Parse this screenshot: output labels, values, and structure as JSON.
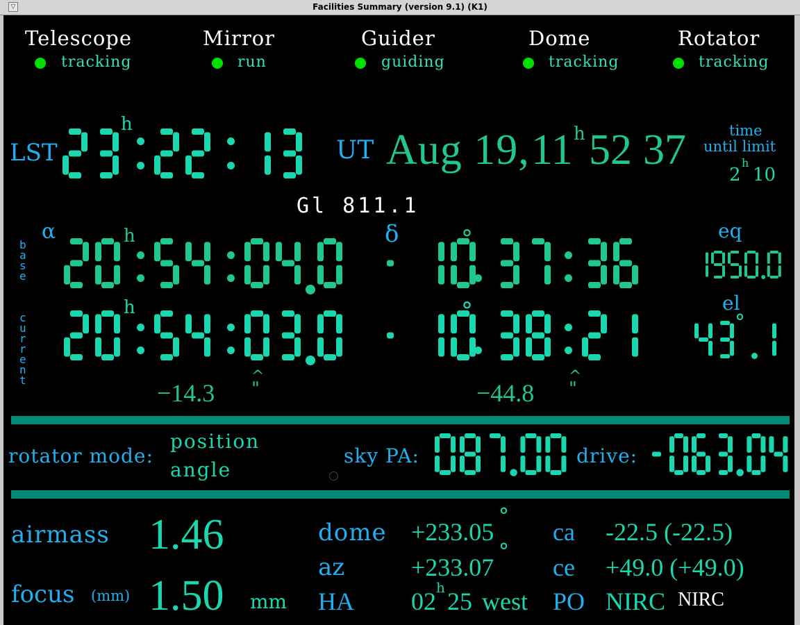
{
  "window": {
    "title": "Facilities Summary (version 9.1) (K1)",
    "menu_icon": "window-menu-icon",
    "menu_glyph": "▽"
  },
  "colors": {
    "background": "#000000",
    "label": "#1fb0f0",
    "digits": "#19d8b0",
    "ok_indicator": "#00e000",
    "separator": "#008a78"
  },
  "status": {
    "telescope": {
      "label": "Telescope",
      "state": "tracking"
    },
    "mirror": {
      "label": "Mirror",
      "state": "run"
    },
    "guider": {
      "label": "Guider",
      "state": "guiding"
    },
    "dome": {
      "label": "Dome",
      "state": "tracking"
    },
    "rotator": {
      "label": "Rotator",
      "state": "tracking"
    }
  },
  "time": {
    "lst_label": "LST",
    "lst": {
      "h": "23",
      "h_unit": "h",
      "m": "22",
      "s": "13"
    },
    "ut_label": "UT",
    "ut_date": "Aug 19,",
    "ut_hour": "11",
    "ut_h_unit": "h",
    "ut_min": "52",
    "ut_sec": "37",
    "limit_label_1": "time",
    "limit_label_2": "until limit",
    "limit_h": "2",
    "limit_h_unit": "h",
    "limit_m": "10"
  },
  "target": {
    "name": "Gl 811.1"
  },
  "coords": {
    "alpha_symbol": "α",
    "delta_symbol": "δ",
    "base_label": "base",
    "current_label": "current",
    "base_ra": {
      "h": "20",
      "h_unit": "h",
      "m": "54",
      "s": "04",
      "frac": "0"
    },
    "base_dec": {
      "sign": "-",
      "d": "10",
      "d_unit": "°",
      "m": "37",
      "s": "36"
    },
    "current_ra": {
      "h": "20",
      "h_unit": "h",
      "m": "54",
      "s": "03",
      "frac": "0"
    },
    "current_dec": {
      "sign": "-",
      "d": "10",
      "d_unit": "°",
      "m": "38",
      "s": "21"
    },
    "ra_offset": "−14.3",
    "dec_offset": "−44.8",
    "offset_unit": "\"",
    "eq_label": "eq",
    "eq_value": "1950.0",
    "el_label": "el",
    "el_value": {
      "deg": "43",
      "deg_unit": "°",
      "frac": "1"
    }
  },
  "rotator": {
    "mode_label": "rotator mode:",
    "mode_value_1": "position",
    "mode_value_2": "angle",
    "sky_pa_label": "sky PA:",
    "sky_pa_value": "087.00",
    "drive_label": "drive:",
    "drive_value": "-063.04"
  },
  "bottom": {
    "airmass_label": "airmass",
    "airmass_value": "1.46",
    "focus_label": "focus",
    "focus_unit_paren": "(mm)",
    "focus_value": "1.50",
    "focus_unit": "mm",
    "dome_label": "dome",
    "dome_value": "+233.05",
    "az_label": "az",
    "az_value": "+233.07",
    "deg_symbol": "°",
    "ha_label": "HA",
    "ha_h": "02",
    "ha_h_unit": "h",
    "ha_m": "25",
    "ha_dir": "west",
    "ca_label": "ca",
    "ca_value": "-22.5 (-22.5)",
    "ce_label": "ce",
    "ce_value": "+49.0 (+49.0)",
    "po_label": "PO",
    "po_value": "NIRC",
    "instrument": "NIRC"
  }
}
